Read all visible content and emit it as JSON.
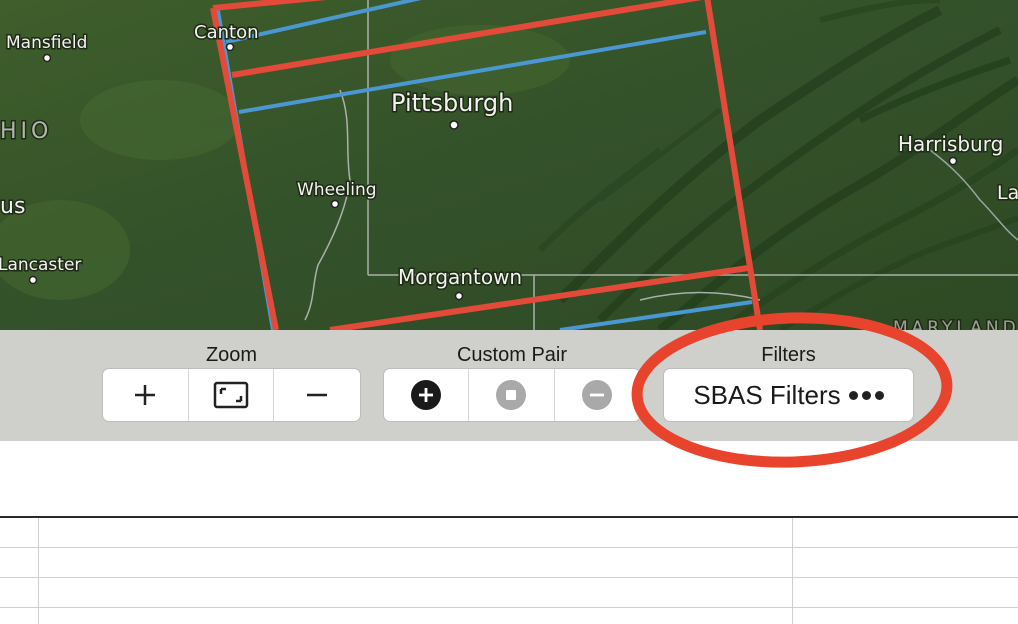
{
  "map": {
    "cities": [
      {
        "name": "Mansfield"
      },
      {
        "name": "Canton"
      },
      {
        "name": "Pittsburgh"
      },
      {
        "name": "Wheeling"
      },
      {
        "name": "Harrisburg"
      },
      {
        "name": "Lancaster"
      },
      {
        "name": "Morgantown"
      }
    ],
    "region_labels": [
      "HIO",
      "us",
      "La",
      "MARYLAND"
    ],
    "colors": {
      "frame": "#e34a3a",
      "burst": "#4a97d1",
      "land": "#3c5a2a"
    }
  },
  "toolbar": {
    "zoom": {
      "label": "Zoom",
      "buttons": [
        {
          "icon": "plus-icon"
        },
        {
          "icon": "fit-extent-icon"
        },
        {
          "icon": "minus-icon"
        }
      ]
    },
    "custom_pair": {
      "label": "Custom Pair",
      "buttons": [
        {
          "icon": "add-circle-icon"
        },
        {
          "icon": "stop-circle-icon"
        },
        {
          "icon": "remove-circle-icon"
        }
      ]
    },
    "filters": {
      "label": "Filters",
      "button_label": "SBAS Filters"
    }
  },
  "annotation": {
    "color": "#e8432d"
  }
}
